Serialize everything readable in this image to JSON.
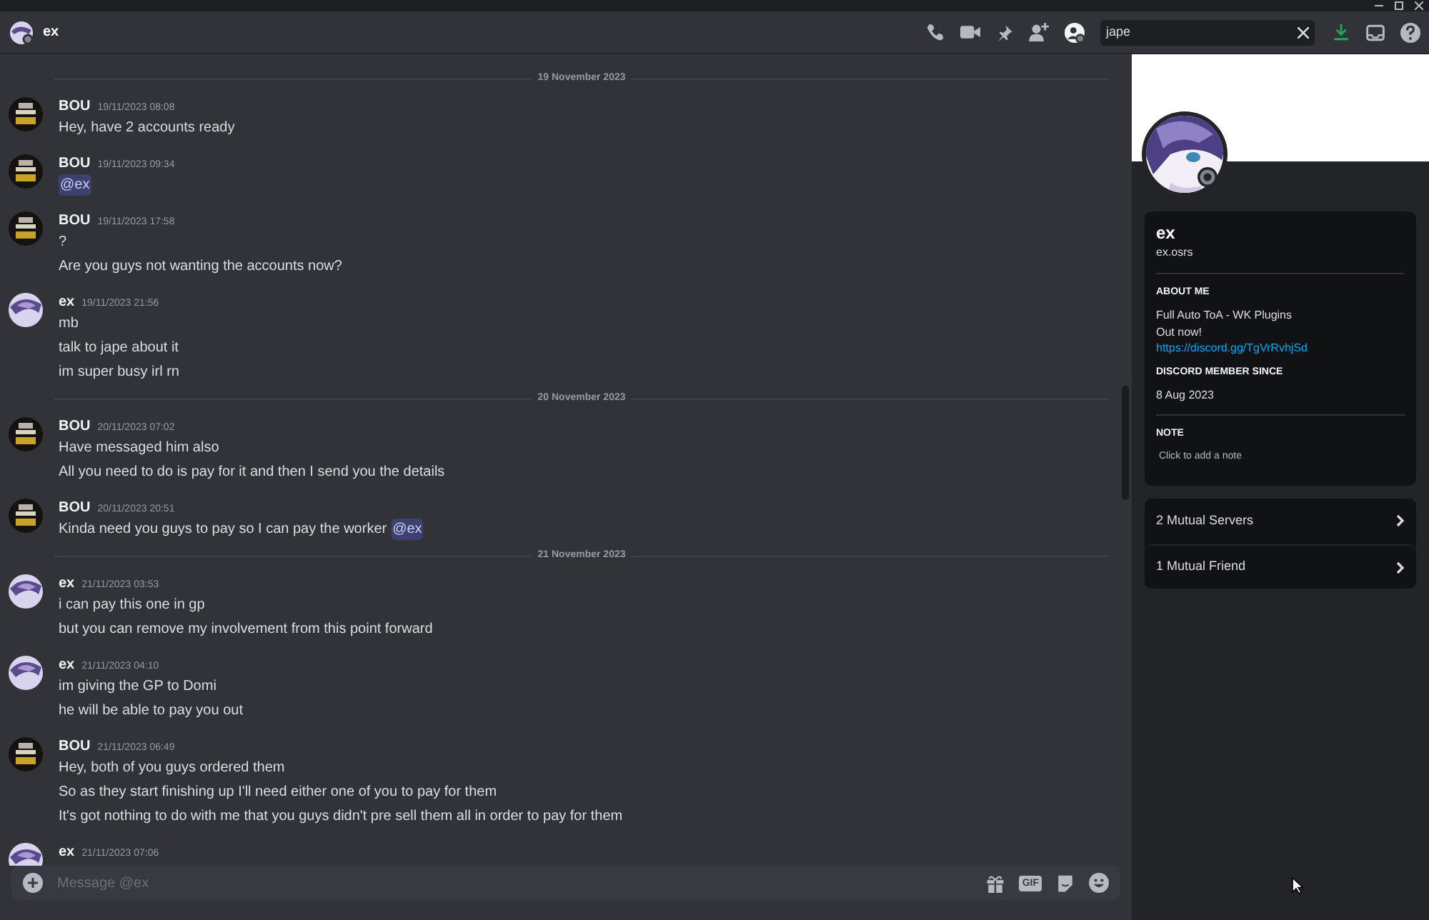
{
  "header": {
    "title": "ex",
    "search": {
      "value": "jape"
    }
  },
  "chat": {
    "items": [
      {
        "kind": "divider",
        "label": "19 November 2023"
      },
      {
        "kind": "message",
        "author": "BOU",
        "color": "#15130f",
        "time": "19/11/2023 08:08",
        "lines": [
          {
            "text": "Hey, have 2 accounts ready"
          }
        ]
      },
      {
        "kind": "message",
        "author": "BOU",
        "color": "#15130f",
        "time": "19/11/2023 09:34",
        "lines": [
          {
            "mention": "@ex"
          }
        ]
      },
      {
        "kind": "message",
        "author": "BOU",
        "color": "#15130f",
        "time": "19/11/2023 17:58",
        "lines": [
          {
            "text": "?"
          },
          {
            "text": "Are you guys not wanting the accounts now?"
          }
        ]
      },
      {
        "kind": "message",
        "author": "ex",
        "color": "#d9d4ee",
        "time": "19/11/2023 21:56",
        "lines": [
          {
            "text": "mb"
          },
          {
            "text": "talk to jape about it"
          },
          {
            "text": "im super busy irl rn"
          }
        ]
      },
      {
        "kind": "divider",
        "label": "20 November 2023"
      },
      {
        "kind": "message",
        "author": "BOU",
        "color": "#15130f",
        "time": "20/11/2023 07:02",
        "lines": [
          {
            "text": "Have messaged him also"
          },
          {
            "text": "All you need to do is pay for it and then I send you the details"
          }
        ]
      },
      {
        "kind": "message",
        "author": "BOU",
        "color": "#15130f",
        "time": "20/11/2023 20:51",
        "lines": [
          {
            "text": "Kinda need you guys to pay so I can pay the worker",
            "mention": "@ex"
          }
        ]
      },
      {
        "kind": "divider",
        "label": "21 November 2023"
      },
      {
        "kind": "message",
        "author": "ex",
        "color": "#d9d4ee",
        "time": "21/11/2023 03:53",
        "lines": [
          {
            "text": "i can pay this one in gp"
          },
          {
            "text": "but you can remove my involvement from this point forward"
          }
        ]
      },
      {
        "kind": "message",
        "author": "ex",
        "color": "#d9d4ee",
        "time": "21/11/2023 04:10",
        "lines": [
          {
            "text": "im giving the GP to Domi"
          },
          {
            "text": "he will be able to pay you out"
          }
        ]
      },
      {
        "kind": "message",
        "author": "BOU",
        "color": "#15130f",
        "time": "21/11/2023 06:49",
        "lines": [
          {
            "text": "Hey, both of you guys ordered them"
          },
          {
            "text": "So as they start finishing up I'll need either one of you to pay for them"
          },
          {
            "text": "It's got nothing to do with me that you guys didn't pre sell them all in order to pay for them"
          }
        ]
      },
      {
        "kind": "message",
        "author": "ex",
        "color": "#d9d4ee",
        "time": "21/11/2023 07:06"
      }
    ],
    "composer": {
      "placeholder": "Message @ex",
      "gif": "GIF"
    }
  },
  "profile": {
    "display_name": "ex",
    "username": "ex.osrs",
    "sections": [
      {
        "heading": "ABOUT ME",
        "lines": [
          "Full Auto ToA - WK Plugins",
          "Out now!"
        ],
        "link": "https://discord.gg/TgVrRvhjSd"
      },
      {
        "heading": "DISCORD MEMBER SINCE",
        "lines": [
          "8 Aug 2023"
        ]
      },
      {
        "heading": "NOTE",
        "placeholder": "Click to add a note"
      }
    ],
    "mutuals": [
      "2 Mutual Servers",
      "1 Mutual Friend"
    ]
  }
}
